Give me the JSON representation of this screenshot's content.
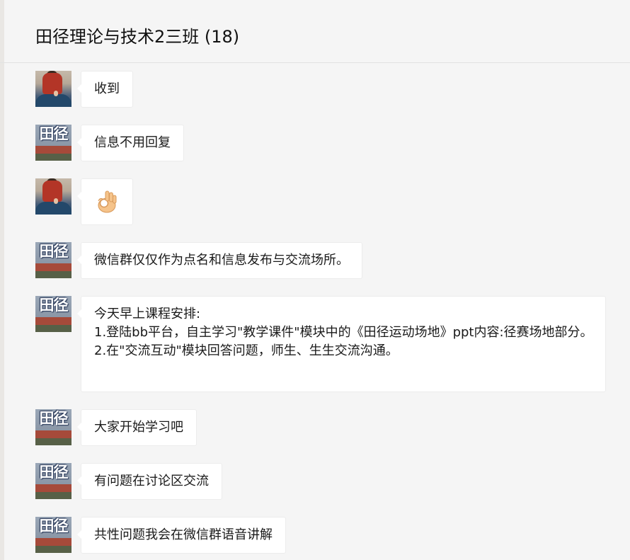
{
  "header": {
    "title": "田径理论与技术2三班 (18)"
  },
  "avatars": {
    "teacher_text": "田径"
  },
  "messages": [
    {
      "sender": "student",
      "text": "收到"
    },
    {
      "sender": "teacher",
      "text": "信息不用回复"
    },
    {
      "sender": "student",
      "emoji": "ok-hand-icon"
    },
    {
      "sender": "teacher",
      "text": "微信群仅仅作为点名和信息发布与交流场所。"
    },
    {
      "sender": "teacher",
      "lines": [
        "今天早上课程安排:",
        "1.登陆bb平台，自主学习\"教学课件\"模块中的《田径运动场地》ppt内容:径赛场地部分。",
        "2.在\"交流互动\"模块回答问题，师生、生生交流沟通。"
      ]
    },
    {
      "sender": "teacher",
      "text": "大家开始学习吧"
    },
    {
      "sender": "teacher",
      "text": "有问题在讨论区交流"
    },
    {
      "sender": "teacher",
      "text": "共性问题我会在微信群语音讲解"
    }
  ],
  "colors": {
    "background": "#f5f5f5",
    "bubble": "#ffffff",
    "text": "#1a1a1a"
  }
}
